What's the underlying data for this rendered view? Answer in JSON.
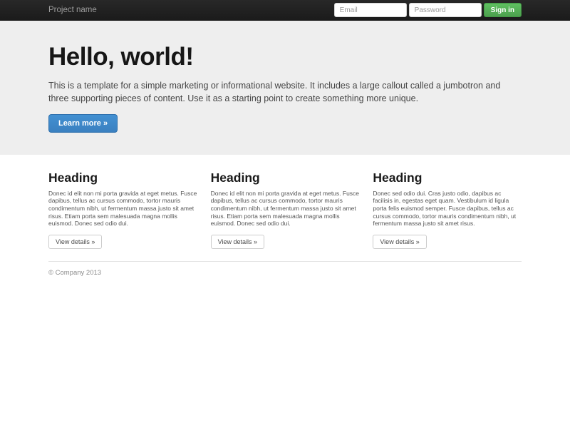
{
  "navbar": {
    "brand": "Project name",
    "email_placeholder": "Email",
    "password_placeholder": "Password",
    "sign_in_label": "Sign in"
  },
  "jumbotron": {
    "title": "Hello, world!",
    "description": "This is a template for a simple marketing or informational website. It includes a large callout called a jumbotron and three supporting pieces of content. Use it as a starting point to create something more unique.",
    "cta_label": "Learn more »"
  },
  "columns": [
    {
      "heading": "Heading",
      "text": "Donec id elit non mi porta gravida at eget metus. Fusce dapibus, tellus ac cursus commodo, tortor mauris condimentum nibh, ut fermentum massa justo sit amet risus. Etiam porta sem malesuada magna mollis euismod. Donec sed odio dui.",
      "button_label": "View details »"
    },
    {
      "heading": "Heading",
      "text": "Donec id elit non mi porta gravida at eget metus. Fusce dapibus, tellus ac cursus commodo, tortor mauris condimentum nibh, ut fermentum massa justo sit amet risus. Etiam porta sem malesuada magna mollis euismod. Donec sed odio dui.",
      "button_label": "View details »"
    },
    {
      "heading": "Heading",
      "text": "Donec sed odio dui. Cras justo odio, dapibus ac facilisis in, egestas eget quam. Vestibulum id ligula porta felis euismod semper. Fusce dapibus, tellus ac cursus commodo, tortor mauris condimentum nibh, ut fermentum massa justo sit amet risus.",
      "button_label": "View details »"
    }
  ],
  "footer": {
    "copyright": "© Company 2013"
  },
  "colors": {
    "navbar_bg": "#222222",
    "jumbotron_bg": "#eeeeee",
    "primary_accent": "#428bca",
    "success_accent": "#5cb85c",
    "muted_text": "#999999"
  }
}
